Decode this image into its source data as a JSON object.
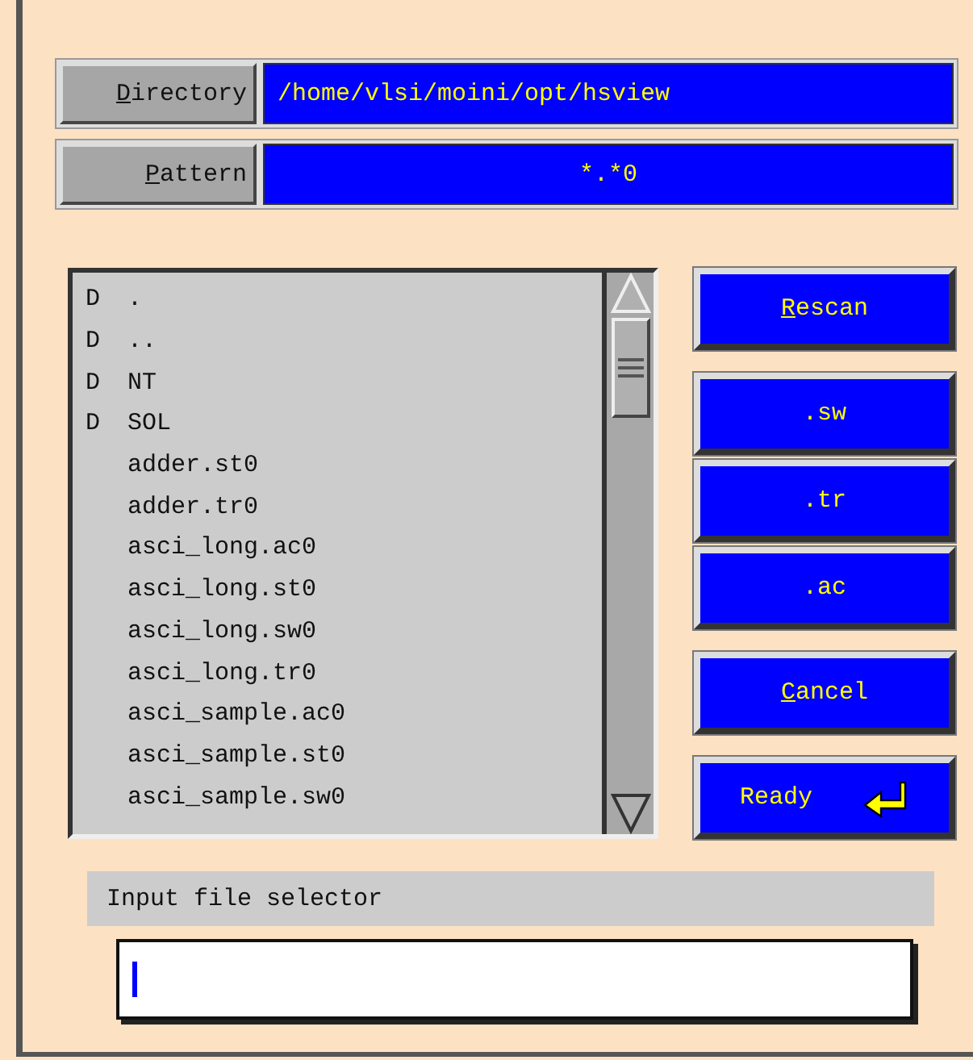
{
  "fields": [
    {
      "label": "Directory",
      "underlined_first": true,
      "value": "/home/vlsi/moini/opt/hsview",
      "kind": "path"
    },
    {
      "label": "Pattern",
      "underlined_first": true,
      "value": "*.*0",
      "kind": "pattern"
    }
  ],
  "files": [
    {
      "kind": "dir",
      "marker": "D",
      "name": "."
    },
    {
      "kind": "dir",
      "marker": "D",
      "name": ".."
    },
    {
      "kind": "dir",
      "marker": "D",
      "name": "NT"
    },
    {
      "kind": "dir",
      "marker": "D",
      "name": "SOL"
    },
    {
      "kind": "file",
      "name": "adder.st0"
    },
    {
      "kind": "file",
      "name": "adder.tr0"
    },
    {
      "kind": "file",
      "name": "asci_long.ac0"
    },
    {
      "kind": "file",
      "name": "asci_long.st0"
    },
    {
      "kind": "file",
      "name": "asci_long.sw0"
    },
    {
      "kind": "file",
      "name": "asci_long.tr0"
    },
    {
      "kind": "file",
      "name": "asci_sample.ac0"
    },
    {
      "kind": "file",
      "name": "asci_sample.st0"
    },
    {
      "kind": "file",
      "name": "asci_sample.sw0"
    }
  ],
  "button_groups": [
    [
      {
        "label": "Rescan",
        "underlined_first": true
      }
    ],
    [
      {
        "label": ".sw",
        "underlined_first": false
      },
      {
        "label": ".tr",
        "underlined_first": false
      },
      {
        "label": ".ac",
        "underlined_first": false
      }
    ],
    [
      {
        "label": "Cancel",
        "underlined_first": true
      }
    ],
    [
      {
        "label": "Ready",
        "underlined_first": false,
        "kind": "enter"
      }
    ]
  ],
  "prompt": {
    "label": "Input file selector"
  }
}
